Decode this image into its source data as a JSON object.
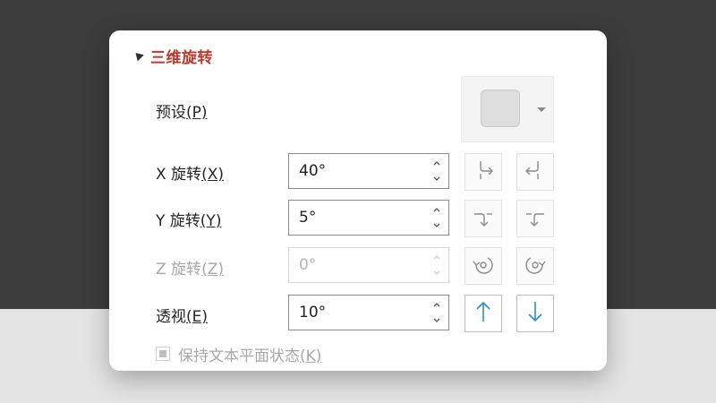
{
  "section": {
    "title": "三维旋转"
  },
  "preset": {
    "label": "预设",
    "accesskey": "(P)"
  },
  "rows": [
    {
      "label": "X 旋转",
      "accesskey": "(X)",
      "value": "40°",
      "enabled": true
    },
    {
      "label": "Y 旋转",
      "accesskey": "(Y)",
      "value": "5°",
      "enabled": true
    },
    {
      "label": "Z 旋转",
      "accesskey": "(Z)",
      "value": "0°",
      "enabled": false
    },
    {
      "label": "透视",
      "accesskey": "(E)",
      "value": "10°",
      "enabled": true
    }
  ],
  "checkbox": {
    "label": "保持文本平面状态",
    "accesskey": "(K)",
    "checked": "indeterminate",
    "enabled": false
  },
  "icons": {
    "x_left": "rotate-left-icon",
    "x_right": "rotate-right-icon",
    "y_up": "rotate-up-icon",
    "y_down": "rotate-down-icon",
    "z_ccw": "rotate-counterclockwise-icon",
    "z_cw": "rotate-clockwise-icon",
    "p_increase": "arrow-up-icon",
    "p_decrease": "arrow-down-icon"
  },
  "colors": {
    "accent_title": "#c0392b",
    "arrow_blue": "#2b8ed6",
    "disabled_gray": "#a8a8a8"
  }
}
